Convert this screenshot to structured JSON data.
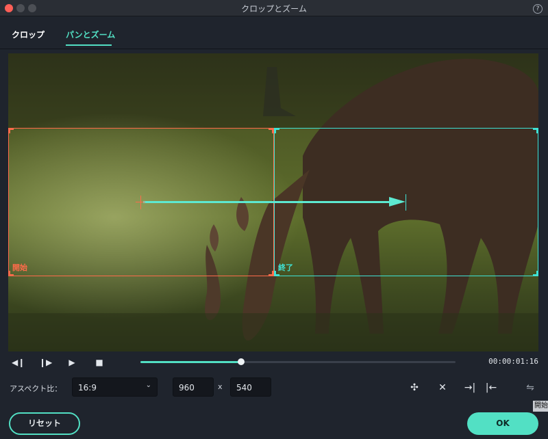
{
  "window": {
    "title": "クロップとズーム",
    "help": "?"
  },
  "tabs": [
    {
      "label": "クロップ",
      "active": false
    },
    {
      "label": "パンとズーム",
      "active": true
    }
  ],
  "preview": {
    "start_label": "開始",
    "end_label": "終了"
  },
  "transport": {
    "timecode": "00:00:01:16",
    "progress": 0.32
  },
  "aspect": {
    "label": "アスペクト比：",
    "ratio": "16:9",
    "width": "960",
    "x": "x",
    "height": "540"
  },
  "tooltip": "開始",
  "buttons": {
    "reset": "リセット",
    "ok": "OK"
  },
  "colors": {
    "accent": "#52e0c4",
    "start_frame": "#ff6b4a",
    "end_frame": "#3fe3d6"
  },
  "icons": [
    "play-prev-frame-icon",
    "play-next-frame-icon",
    "play-icon",
    "stop-icon",
    "fit-icon",
    "fill-icon",
    "set-end-icon",
    "set-start-icon",
    "swap-icon"
  ]
}
